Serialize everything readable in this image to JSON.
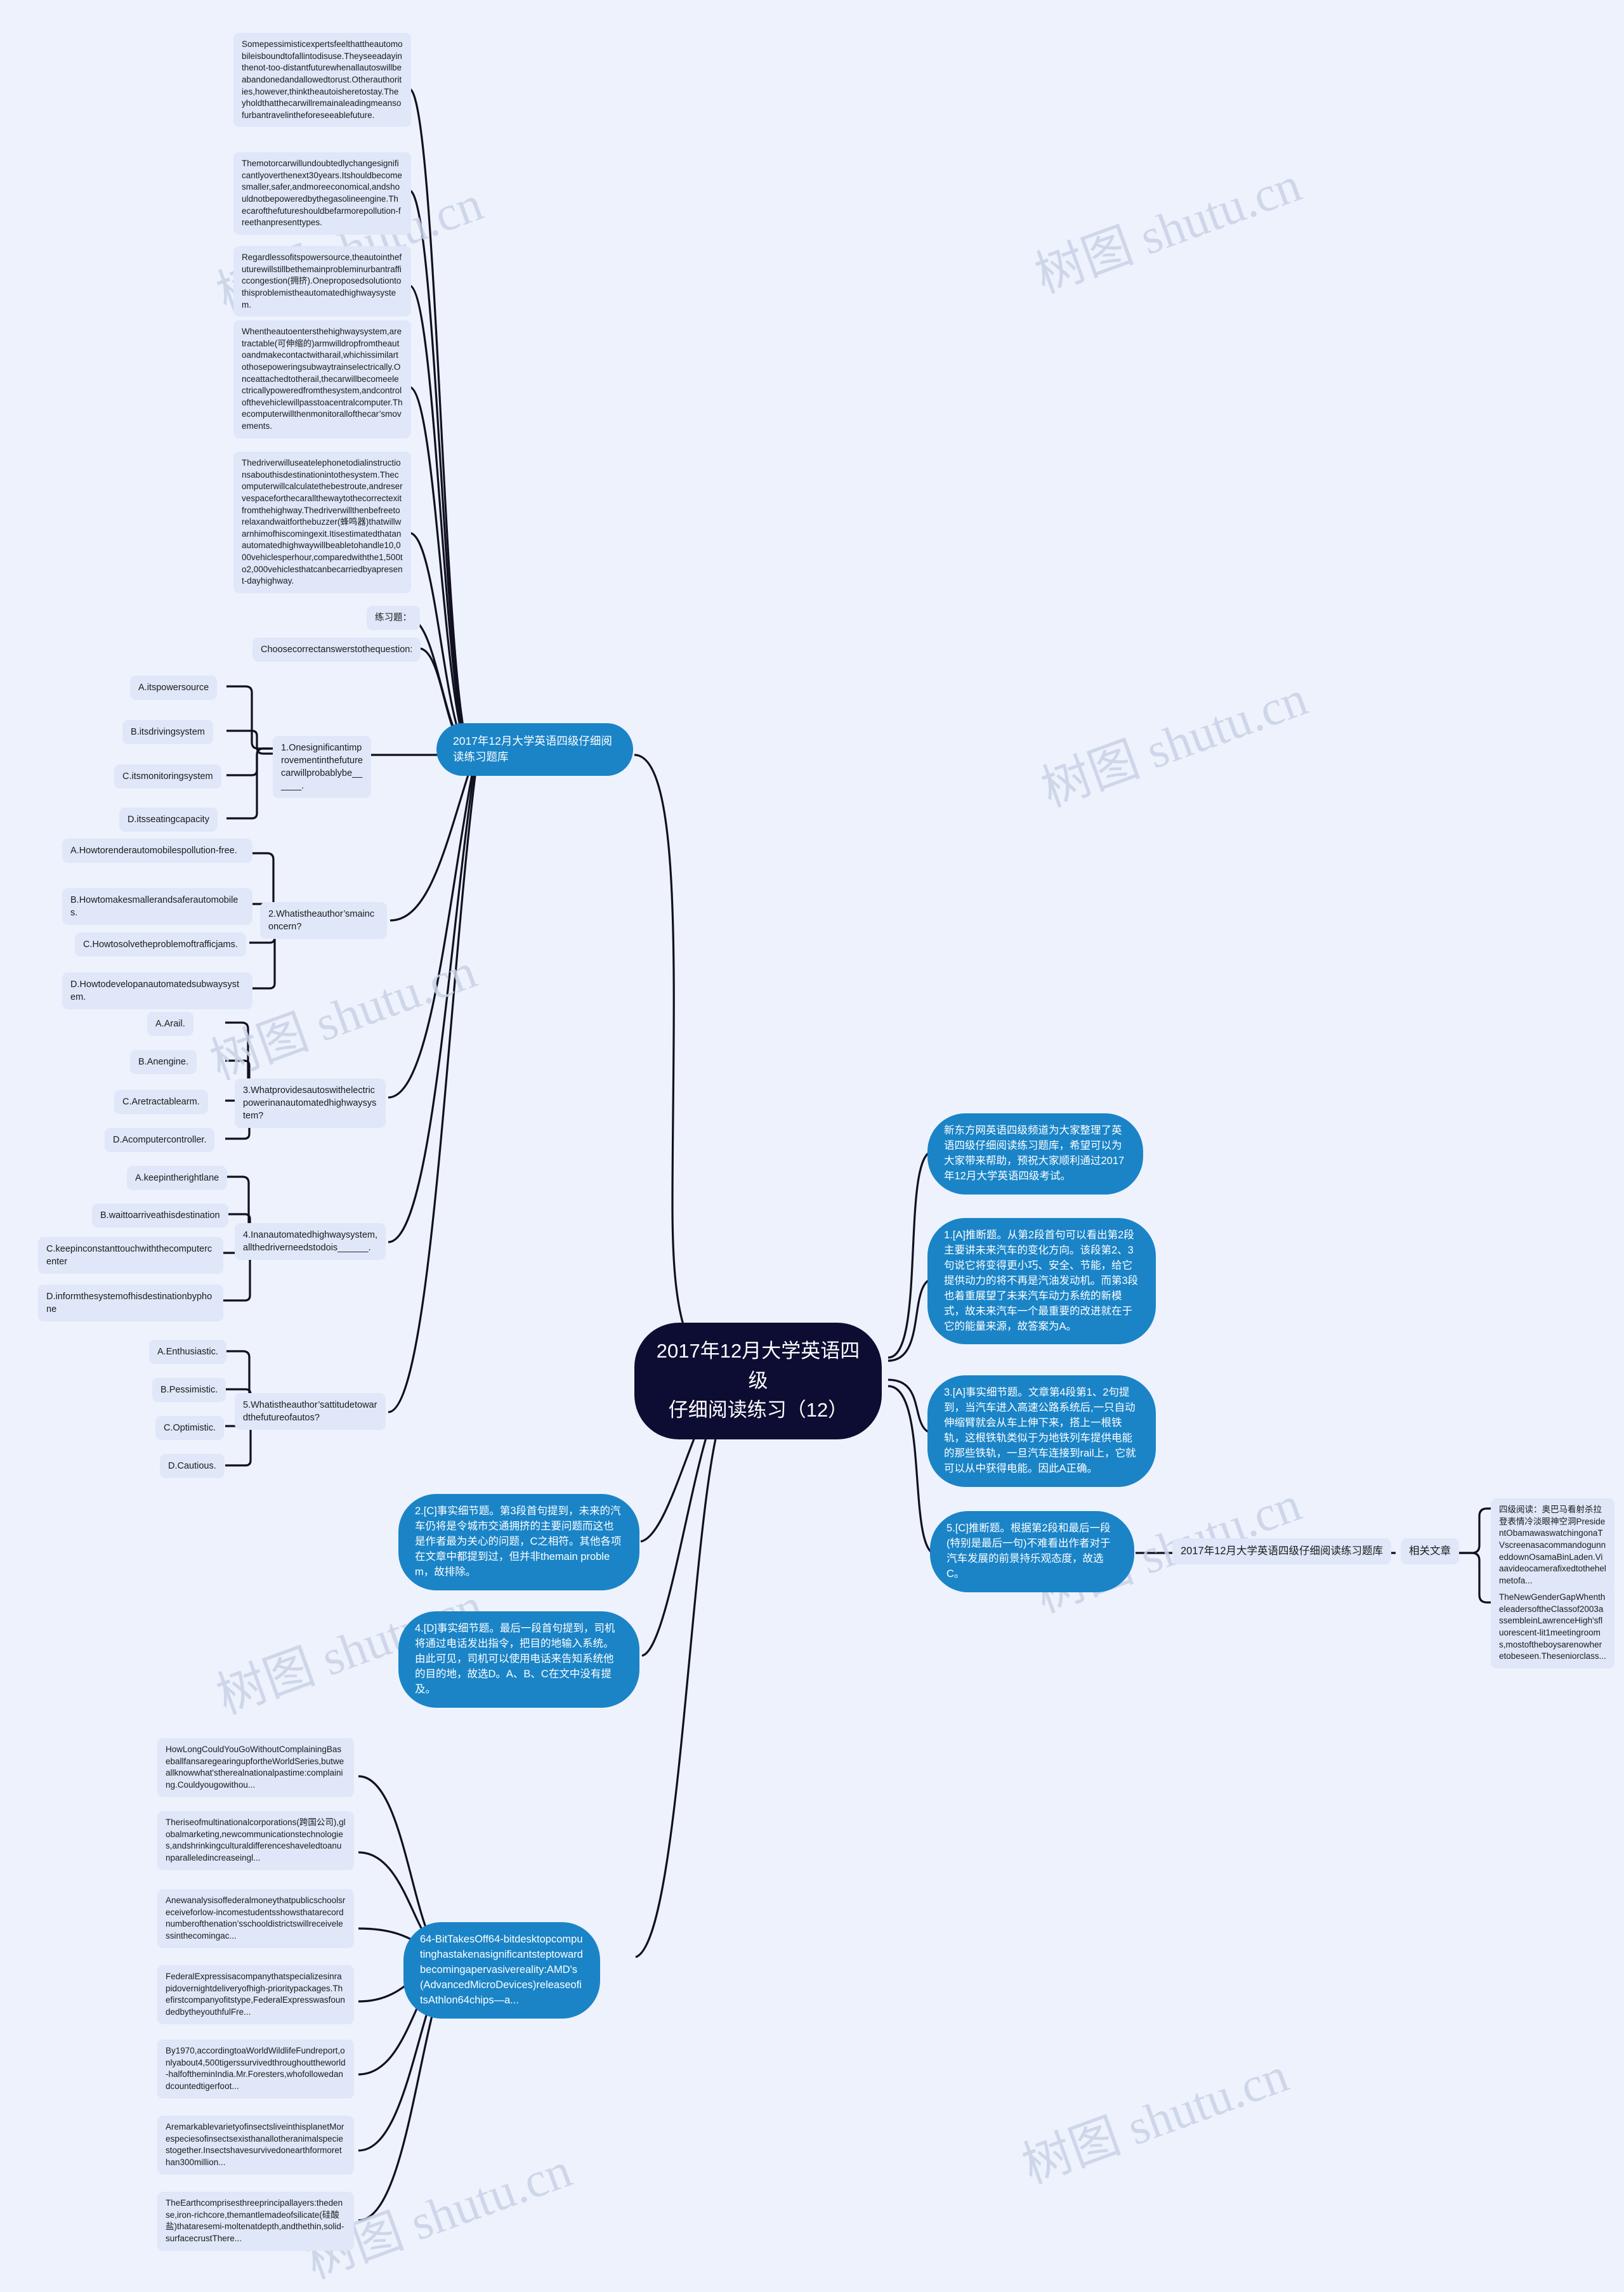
{
  "root": {
    "title": "2017年12月大学英语四级\n仔细阅读练习（12）"
  },
  "watermark": {
    "text": "树图 shutu.cn"
  },
  "branch_labels": {
    "question_bank_left": "2017年12月大学英语四级仔细阅读练习题库",
    "question_bank_right": "2017年12月大学英语四级仔细阅读练习题库",
    "related_articles": "相关文章"
  },
  "passage": {
    "paragraphs": [
      "Somepessimisticexpertsfeelthattheautomobileisboundtofallintodisuse.Theyseeadayinthenot-too-distantfuturewhenallautoswillbeabandonedandallowedtorust.Otherauthorities,however,thinktheautoisheretostay.Theyholdthatthecarwillremainaleadingmeansofurbantravelintheforeseeablefuture.",
      "Themotorcarwillundoubtedlychangesignificantlyoverthenext30years.Itshouldbecomesmaller,safer,andmoreeconomical,andshouldnotbepoweredbythegasolineengine.Thecarofthefutureshouldbefarmorepollution-freethanpresenttypes.",
      "Regardlessofitspowersource,theautointhefuturewillstillbethemainprobleminurbantrafficcongestion(拥挤).Oneproposedsolutiontothisproblemistheautomatedhighwaysystem.",
      "Whentheautoentersthehighwaysystem,aretractable(可伸缩的)armwilldropfromtheautoandmakecontactwitharail,whichissimilartothosepoweringsubwaytrainselectrically.Onceattachedtotherail,thecarwillbecomeelectricallypoweredfromthesystem,andcontrolofthevehiclewillpasstoacentralcomputer.Thecomputerwillthenmonitorallofthecar’smovements.",
      "Thedriverwilluseatelephonetodialinstructionsabouthisdestinationintothesystem.Thecomputerwillcalculatethebestroute,andreservespaceforthecarallthewaytothecorrectexitfromthehighway.Thedriverwillthenbefreetorelaxandwaitforthebuzzer(蜂鸣器)thatwillwarnhimofhiscomingexit.Itisestimatedthatanautomatedhighwaywillbeabletohandle10,000vehiclesperhour,comparedwiththe1,500to2,000vehiclesthatcanbecarriedbyapresent-dayhighway."
    ]
  },
  "exercise": {
    "heading": "练习题：",
    "instruction": "Choosecorrectanswerstothequestion:"
  },
  "questions": [
    {
      "stem": "1.Onesignificantimprovementinthefuturecarwillprobablybe______.",
      "options": [
        "A.itspowersource",
        "B.itsdrivingsystem",
        "C.itsmonitoringsystem",
        "D.itsseatingcapacity"
      ]
    },
    {
      "stem": "2.Whatistheauthor’smainconcern?",
      "options": [
        "A.Howtorenderautomobilespollution-free.",
        "B.Howtomakesmallerandsaferautomobiles.",
        "C.Howtosolvetheproblemoftrafficjams.",
        "D.Howtodevelopanautomatedsubwaysystem."
      ]
    },
    {
      "stem": "3.Whatprovidesautoswithelectricpowerinanautomatedhighwaysystem?",
      "options": [
        "A.Arail.",
        "B.Anengine.",
        "C.Aretractablearm.",
        "D.Acomputercontroller."
      ]
    },
    {
      "stem": "4.Inanautomatedhighwaysystem,allthedriverneedstodois______.",
      "options": [
        "A.keepintherightlane",
        "B.waittoarriveathisdestination",
        "C.keepinconstanttouchwiththecomputercenter",
        "D.informthesystemofhisdestinationbyphone"
      ]
    },
    {
      "stem": "5.Whatistheauthor’sattitudetowardthefutureofautos?",
      "options": [
        "A.Enthusiastic.",
        "B.Pessimistic.",
        "C.Optimistic.",
        "D.Cautious."
      ]
    }
  ],
  "intro_note": "新东方网英语四级频道为大家整理了英语四级仔细阅读练习题库，希望可以为大家带来帮助，预祝大家顺利通过2017年12月大学英语四级考试。",
  "answers": [
    "1.[A]推断题。从第2段首句可以看出第2段主要讲未来汽车的变化方向。该段第2、3句说它将变得更小巧、安全、节能，给它提供动力的将不再是汽油发动机。而第3段也着重展望了未来汽车动力系统的新模式，故未来汽车一个最重要的改进就在于它的能量来源，故答案为A。",
    "2.[C]事实细节题。第3段首句提到，未来的汽车仍将是令城市交通拥挤的主要问题而这也是作者最为关心的问题，C之相符。其他各项在文章中都提到过，但并非themain problem，故排除。",
    "3.[A]事实细节题。文章第4段第1、2句提到，当汽车进入高速公路系统后,一只自动伸缩臂就会从车上伸下来，搭上一根铁轨，这根铁轨类似于为地铁列车提供电能的那些铁轨，一旦汽车连接到rail上，它就可以从中获得电能。因此A正确。",
    "4.[D]事实细节题。最后一段首句提到，司机将通过电话发出指令，把目的地输入系统。由此可见，司机可以使用电话来告知系统他的目的地，故选D。A、B、C在文中没有提及。",
    "5.[C]推断题。根据第2段和最后一段(特别是最后一句)不难看出作者对于汽车发展的前景持乐观态度，故选C。"
  ],
  "related_articles": [
    "四级阅读：奥巴马看射杀拉登表情冷淡眼神空洞PresidentObamawaswatchingonaTVscreenasacommandogunneddownOsamaBinLaden.Viaavideocamerafixedtothehelmetofa...",
    "TheNewGenderGapWhentheleadersoftheClassof2003assembleinLawrenceHigh'sfluorescent-lit1meetingrooms,mostoftheboysarenowheretobeseen.Theseniorclass..."
  ],
  "article_list": [
    "HowLongCouldYouGoWithoutComplainingBaseballfansaregearingupfortheWorldSeries,butweallknowwhat'stherealnationalpastime:complaining.Couldyougowithou...",
    "Theriseofmultinationalcorporations(跨国公司),globalmarketing,newcommunicationstechnologies,andshrinkingculturaldifferenceshaveledtoanunparalleledincreaseingl...",
    "Anewanalysisoffederalmoneythatpublicschoolsreceiveforlow-incomestudentsshowsthatarecordnumberofthenation’sschooldistrictswillreceivelessinthecomingac...",
    "FederalExpressisacompanythatspecializesinrapidovernightdeliveryofhigh-prioritypackages.Thefirstcompanyofitstype,FederalExpresswasfoundedbytheyouthfulFre...",
    "By1970,accordingtoaWorldWildlifeFundreport,onlyabout4,500tigerssurvivedthroughouttheworld-halfoftheminIndia.Mr.Foresters,whofollowedandcountedtigerfoot...",
    "AremarkablevarietyofinsectsliveinthisplanetMorespeciesofinsectsexisthanallotheranimalspeciestogether.Insectshavesurvivedonearthformorethan300million...",
    "TheEarthcomprisesthreeprincipallayers:thedense,iron-richcore,themantlemadeofsilicate(硅酸盐)thataresemi-moltenatdepth,andthethin,solid-surfacecrustThere..."
  ],
  "feature_node": "64-BitTakesOff64-bitdesktopcomputinghastakenasignificantsteptowardbecomingapervasivereality:AMD's(AdvancedMicroDevices)releaseofitsAthlon64chips—a...",
  "colors": {
    "background": "#eef2fc",
    "chip": "#dfe7f8",
    "pill": "#1a84c7",
    "root": "#0d0d33",
    "line": "#101020"
  }
}
